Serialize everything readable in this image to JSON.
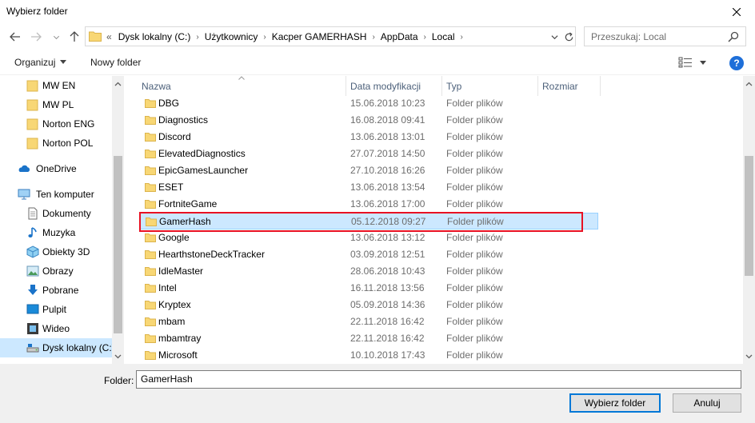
{
  "window": {
    "title": "Wybierz folder"
  },
  "address": {
    "prefix": "«",
    "crumbs": [
      "Dysk lokalny (C:)",
      "Użytkownicy",
      "Kacper GAMERHASH",
      "AppData",
      "Local"
    ]
  },
  "search": {
    "placeholder": "Przeszukaj: Local"
  },
  "toolbar": {
    "organize": "Organizuj",
    "new_folder": "Nowy folder"
  },
  "sidebar": {
    "items": [
      {
        "label": "MW EN",
        "icon": "folder-icon"
      },
      {
        "label": "MW PL",
        "icon": "folder-icon"
      },
      {
        "label": "Norton ENG",
        "icon": "folder-icon"
      },
      {
        "label": "Norton POL",
        "icon": "folder-icon"
      },
      {
        "label": "OneDrive",
        "icon": "cloud-icon"
      },
      {
        "label": "Ten komputer",
        "icon": "computer-icon"
      },
      {
        "label": "Dokumenty",
        "icon": "document-icon"
      },
      {
        "label": "Muzyka",
        "icon": "music-icon"
      },
      {
        "label": "Obiekty 3D",
        "icon": "cube-icon"
      },
      {
        "label": "Obrazy",
        "icon": "picture-icon"
      },
      {
        "label": "Pobrane",
        "icon": "download-icon"
      },
      {
        "label": "Pulpit",
        "icon": "desktop-icon"
      },
      {
        "label": "Wideo",
        "icon": "video-icon"
      },
      {
        "label": "Dysk lokalny (C:)",
        "icon": "drive-icon"
      }
    ]
  },
  "columns": {
    "name": "Nazwa",
    "date": "Data modyfikacji",
    "type": "Typ",
    "size": "Rozmiar"
  },
  "files": [
    {
      "name": "DBG",
      "date": "15.06.2018 10:23",
      "type": "Folder plików"
    },
    {
      "name": "Diagnostics",
      "date": "16.08.2018 09:41",
      "type": "Folder plików"
    },
    {
      "name": "Discord",
      "date": "13.06.2018 13:01",
      "type": "Folder plików"
    },
    {
      "name": "ElevatedDiagnostics",
      "date": "27.07.2018 14:50",
      "type": "Folder plików"
    },
    {
      "name": "EpicGamesLauncher",
      "date": "27.10.2018 16:26",
      "type": "Folder plików"
    },
    {
      "name": "ESET",
      "date": "13.06.2018 13:54",
      "type": "Folder plików"
    },
    {
      "name": "FortniteGame",
      "date": "13.06.2018 17:00",
      "type": "Folder plików"
    },
    {
      "name": "GamerHash",
      "date": "05.12.2018 09:27",
      "type": "Folder plików"
    },
    {
      "name": "Google",
      "date": "13.06.2018 13:12",
      "type": "Folder plików"
    },
    {
      "name": "HearthstoneDeckTracker",
      "date": "03.09.2018 12:51",
      "type": "Folder plików"
    },
    {
      "name": "IdleMaster",
      "date": "28.06.2018 10:43",
      "type": "Folder plików"
    },
    {
      "name": "Intel",
      "date": "16.11.2018 13:56",
      "type": "Folder plików"
    },
    {
      "name": "Kryptex",
      "date": "05.09.2018 14:36",
      "type": "Folder plików"
    },
    {
      "name": "mbam",
      "date": "22.11.2018 16:42",
      "type": "Folder plików"
    },
    {
      "name": "mbamtray",
      "date": "22.11.2018 16:42",
      "type": "Folder plików"
    },
    {
      "name": "Microsoft",
      "date": "10.10.2018 17:43",
      "type": "Folder plików"
    }
  ],
  "footer": {
    "folder_label": "Folder:",
    "folder_value": "GamerHash",
    "ok": "Wybierz folder",
    "cancel": "Anuluj"
  },
  "colors": {
    "selection": "#cce8ff",
    "highlight": "#e81123",
    "folder": "#f8d775",
    "accent": "#0078d7"
  }
}
